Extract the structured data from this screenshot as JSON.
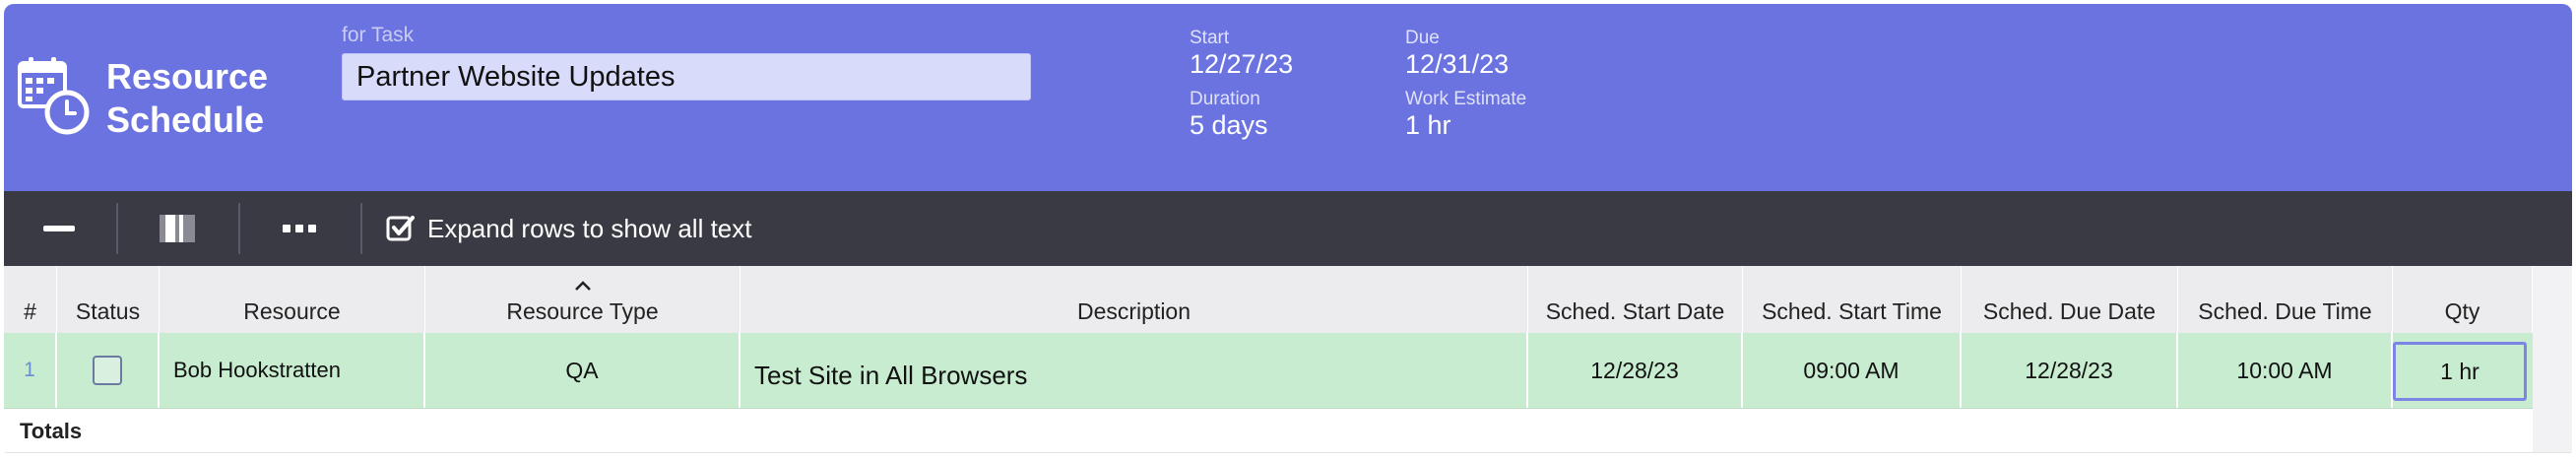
{
  "header": {
    "title_line1": "Resource",
    "title_line2": "Schedule",
    "for_task_label": "for Task",
    "task_name": "Partner Website Updates",
    "start_label": "Start",
    "start_value": "12/27/23",
    "due_label": "Due",
    "due_value": "12/31/23",
    "duration_label": "Duration",
    "duration_value": "5 days",
    "work_estimate_label": "Work Estimate",
    "work_estimate_value": "1 hr",
    "icon": "calendar-clock-icon"
  },
  "toolbar": {
    "buttons": [
      {
        "icon": "minus-icon"
      },
      {
        "icon": "column-toggle-icon"
      },
      {
        "icon": "more-dots-icon"
      }
    ],
    "expand_rows_label": "Expand rows to show all text",
    "expand_rows_checked": true
  },
  "table": {
    "columns": {
      "num": "#",
      "status": "Status",
      "resource": "Resource",
      "resource_type": "Resource Type",
      "description": "Description",
      "sched_start_date": "Sched. Start Date",
      "sched_start_time": "Sched. Start Time",
      "sched_due_date": "Sched. Due Date",
      "sched_due_time": "Sched. Due Time",
      "qty": "Qty"
    },
    "sorted_column": "resource_type",
    "sort_icon": "chevron-up-icon",
    "rows": [
      {
        "num": "1",
        "status_checked": false,
        "resource": "Bob Hookstratten",
        "resource_type": "QA",
        "description": "Test Site in All Browsers",
        "sched_start_date": "12/28/23",
        "sched_start_time": "09:00 AM",
        "sched_due_date": "12/28/23",
        "sched_due_time": "10:00 AM",
        "qty": "1  hr"
      }
    ],
    "totals_label": "Totals"
  },
  "colors": {
    "header_bg": "#6b73e0",
    "toolbar_bg": "#3a3a44",
    "row_selected_bg": "#c8ecd0",
    "focus_border": "#7c84e6"
  }
}
